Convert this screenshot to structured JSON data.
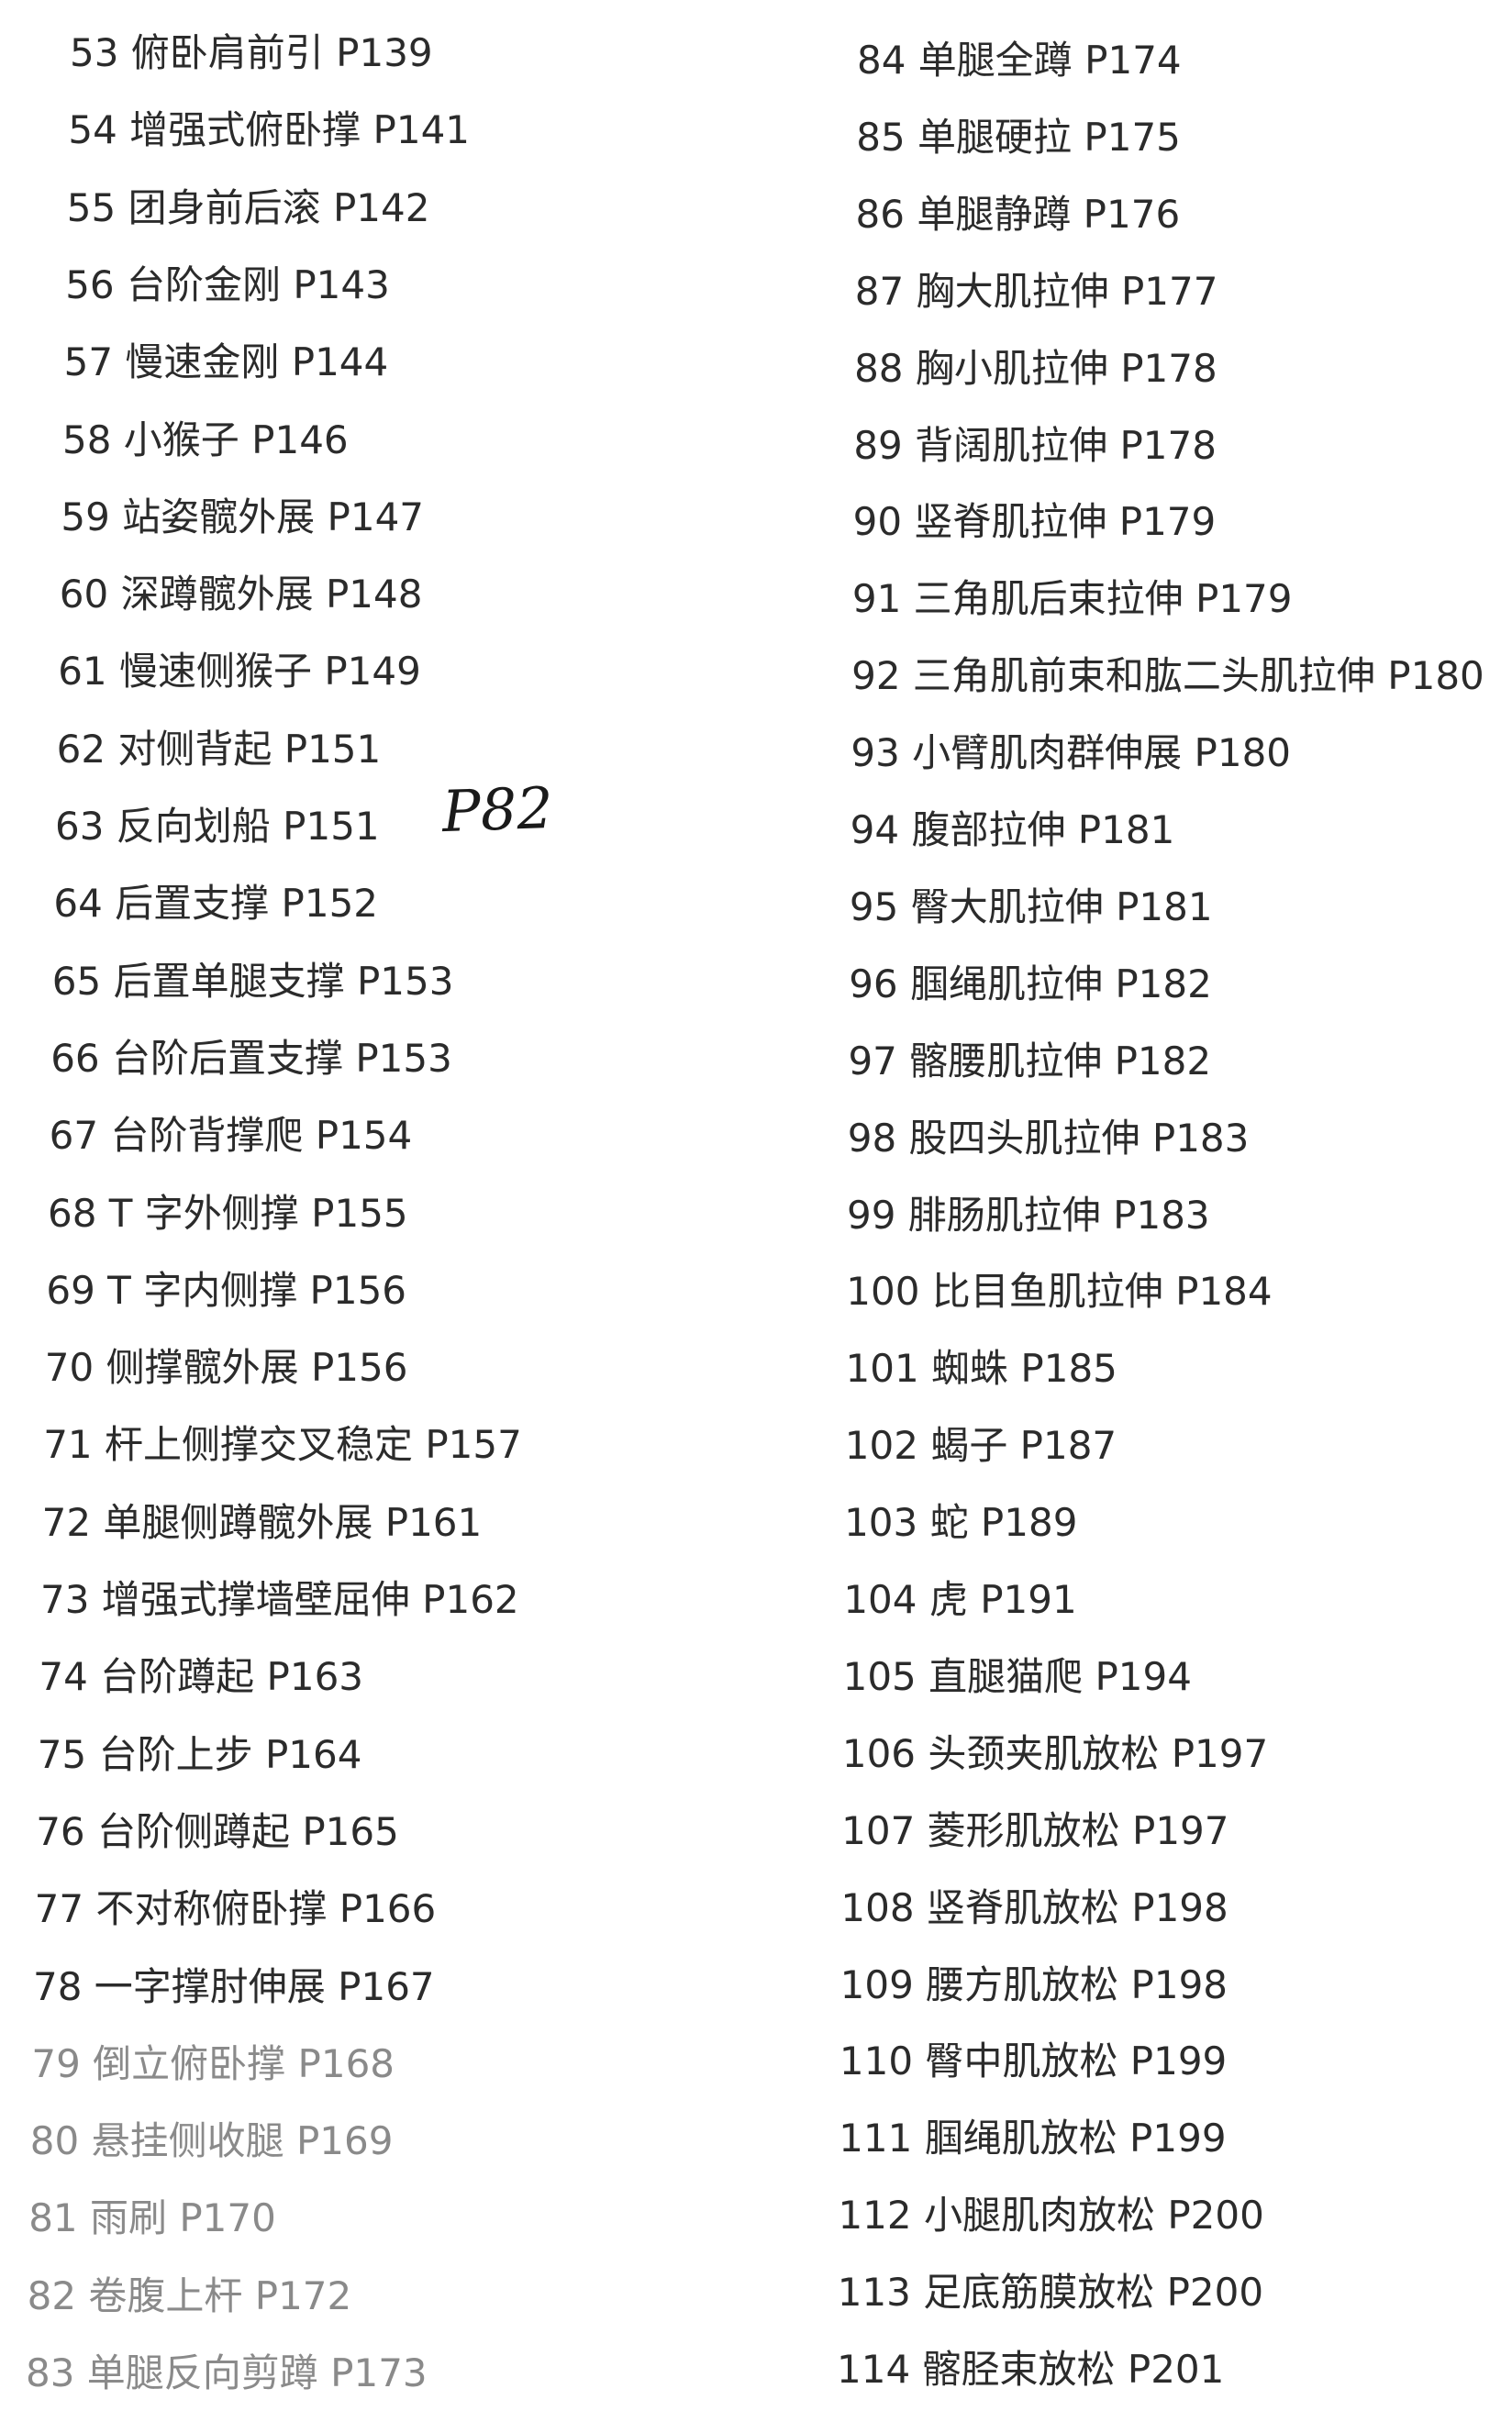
{
  "left_column": [
    "53 俯卧肩前引 P139",
    "54 增强式俯卧撑 P141",
    "55 团身前后滚 P142",
    "56 台阶金刚 P143",
    "57 慢速金刚 P144",
    "58 小猴子 P146",
    "59 站姿髋外展 P147",
    "60 深蹲髋外展 P148",
    "61 慢速侧猴子 P149",
    "62 对侧背起 P151",
    "63 反向划船 P151",
    "64 后置支撑 P152",
    "65 后置单腿支撑 P153",
    "66 台阶后置支撑 P153",
    "67 台阶背撑爬 P154",
    "68 T 字外侧撑 P155",
    "69 T 字内侧撑 P156",
    "70 侧撑髋外展 P156",
    "71 杆上侧撑交叉稳定 P157",
    "72 单腿侧蹲髋外展 P161",
    "73 增强式撑墙壁屈伸 P162",
    "74 台阶蹲起 P163",
    "75 台阶上步 P164",
    "76 台阶侧蹲起 P165",
    "77 不对称俯卧撑 P166",
    "78 一字撑肘伸展 P167",
    "79 倒立俯卧撑 P168",
    "80 悬挂侧收腿 P169",
    "81 雨刷 P170",
    "82 卷腹上杆 P172",
    "83 单腿反向剪蹲 P173"
  ],
  "right_column": [
    "84 单腿全蹲 P174",
    "85 单腿硬拉 P175",
    "86 单腿静蹲 P176",
    "87 胸大肌拉伸 P177",
    "88 胸小肌拉伸 P178",
    "89 背阔肌拉伸 P178",
    "90 竖脊肌拉伸 P179",
    "91 三角肌后束拉伸 P179",
    "92 三角肌前束和肱二头肌拉伸 P180",
    "93 小臂肌肉群伸展 P180",
    "94 腹部拉伸 P181",
    "95 臀大肌拉伸 P181",
    "96 腘绳肌拉伸 P182",
    "97 髂腰肌拉伸 P182",
    "98 股四头肌拉伸 P183",
    "99 腓肠肌拉伸 P183",
    "100 比目鱼肌拉伸 P184",
    "101 蜘蛛 P185",
    "102 蝎子 P187",
    "103 蛇 P189",
    "104 虎 P191",
    "105 直腿猫爬 P194",
    "106 头颈夹肌放松 P197",
    "107 菱形肌放松 P197",
    "108 竖脊肌放松 P198",
    "109 腰方肌放松 P198",
    "110 臀中肌放松 P199",
    "111 腘绳肌放松 P199",
    "112 小腿肌肉放松 P200",
    "113 足底筋膜放松 P200",
    "114 髂胫束放松 P201"
  ],
  "handwritten_note": "P82"
}
